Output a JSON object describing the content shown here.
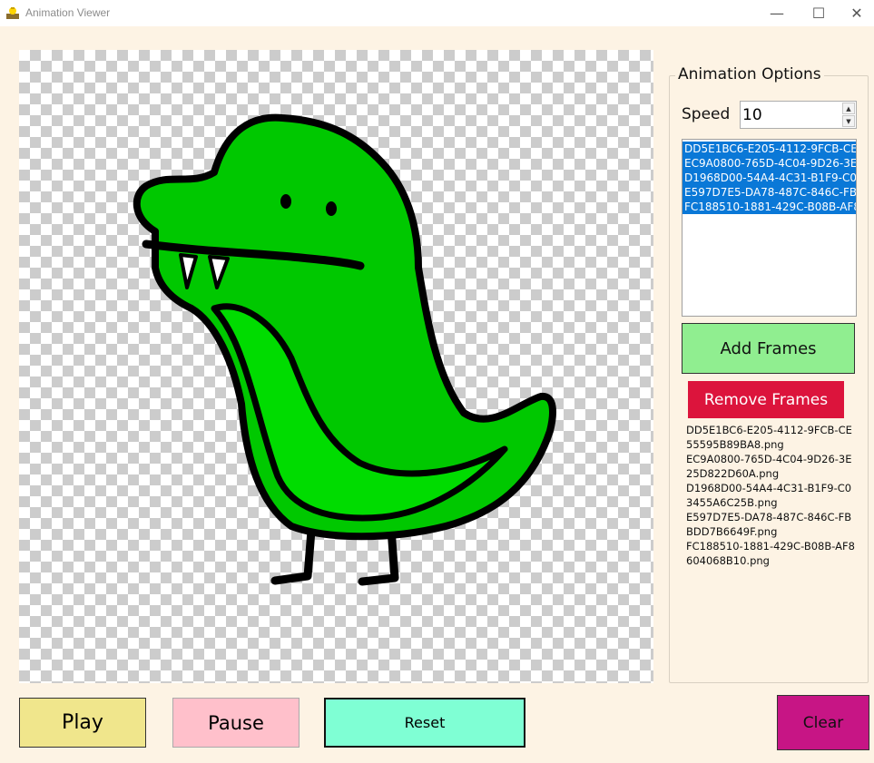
{
  "window": {
    "title": "Animation Viewer",
    "minimize_glyph": "—",
    "maximize_glyph": "☐",
    "close_glyph": "✕"
  },
  "options": {
    "group_title": "Animation Options",
    "speed_label": "Speed",
    "speed_value": "10",
    "spin_up_glyph": "▲",
    "spin_down_glyph": "▼",
    "frames": [
      "DD5E1BC6-E205-4112-9FCB-CE55595B89BA8.png",
      "EC9A0800-765D-4C04-9D26-3E25D822D60A.png",
      "D1968D00-54A4-4C31-B1F9-C03455A6C25B.png",
      "E597D7E5-DA78-487C-846C-FBBDD7B6649F.png",
      "FC188510-1881-429C-B08B-AF8604068B10.png"
    ],
    "add_frames_label": "Add Frames",
    "remove_frames_label": "Remove Frames",
    "frames_text": "DD5E1BC6-E205-4112-9FCB-CE55595B89BA8.png\nEC9A0800-765D-4C04-9D26-3E25D822D60A.png\nD1968D00-54A4-4C31-B1F9-C03455A6C25B.png\nE597D7E5-DA78-487C-846C-FBBDD7B6649F.png\nFC188510-1881-429C-B08B-AF8604068B10.png"
  },
  "controls": {
    "play_label": "Play",
    "pause_label": "Pause",
    "reset_label": "Reset",
    "clear_label": "Clear"
  },
  "colors": {
    "background": "#fdf3e4",
    "play": "#f0e68c",
    "pause": "#ffc0cb",
    "reset": "#7fffd4",
    "clear": "#c71585",
    "add_frames": "#90ee90",
    "remove_frames": "#dc143c",
    "selection": "#0a78d7",
    "dino_green": "#00cc00"
  }
}
